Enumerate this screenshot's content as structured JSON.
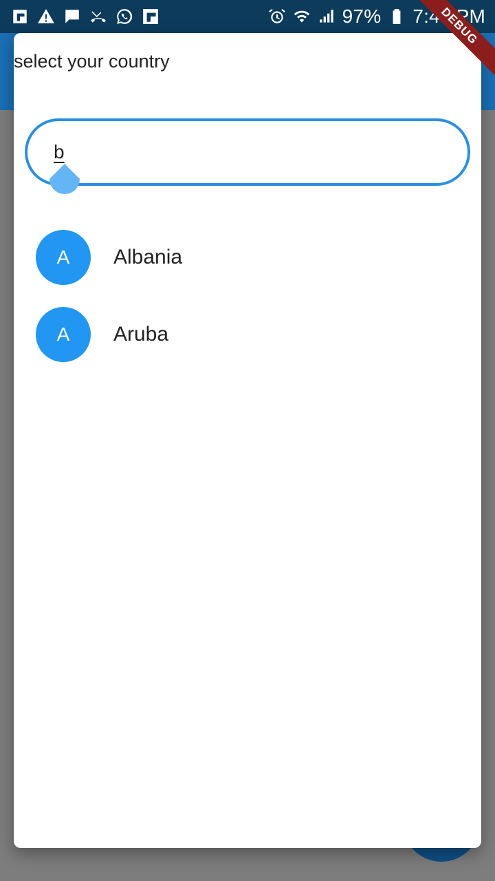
{
  "status_bar": {
    "left_icons": [
      "flipboard-icon",
      "warning-icon",
      "message-icon",
      "missed-call-icon",
      "whatsapp-icon",
      "flipboard-square-icon"
    ],
    "right_icons": [
      "alarm-icon",
      "wifi-icon",
      "signal-icon",
      "battery-icon"
    ],
    "battery_percent": "97%",
    "time": "7:44 PM"
  },
  "debug_banner": "DEBUG",
  "dialog": {
    "title": "select your country",
    "search": {
      "value": "b"
    },
    "countries": [
      {
        "initial": "A",
        "name": "Albania"
      },
      {
        "initial": "A",
        "name": "Aruba"
      }
    ]
  },
  "colors": {
    "status_bar": "#0c3b5c",
    "app_bar": "#1a6fb5",
    "accent": "#2196f3",
    "search_border": "#2a8fe3",
    "scrim": "#7d7d7d",
    "debug_ribbon": "#8c1d1d"
  }
}
